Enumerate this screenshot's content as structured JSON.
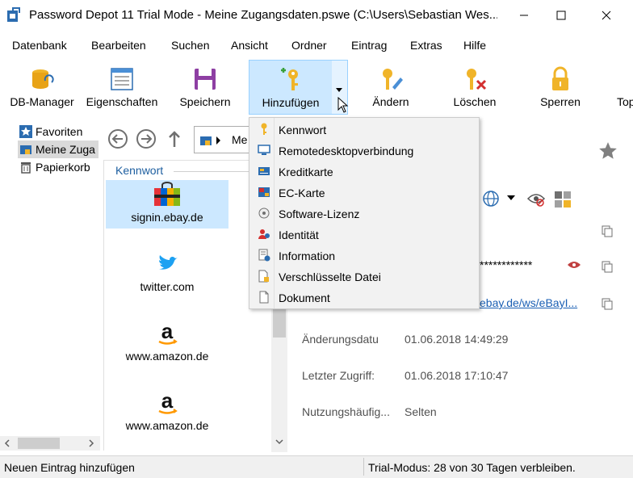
{
  "window": {
    "title": "Password Depot 11 Trial Mode - Meine Zugangsdaten.pswe (C:\\Users\\Sebastian Wes..."
  },
  "menu": [
    "Datenbank",
    "Bearbeiten",
    "Suchen",
    "Ansicht",
    "Ordner",
    "Eintrag",
    "Extras",
    "Hilfe"
  ],
  "toolbar": {
    "db_manager": "DB-Manager",
    "properties": "Eigenschaften",
    "save": "Speichern",
    "add": "Hinzufügen",
    "edit": "Ändern",
    "delete": "Löschen",
    "lock": "Sperren",
    "more": "Top"
  },
  "tree": {
    "favorites": "Favoriten",
    "my_data": "Meine Zuga",
    "trash": "Papierkorb"
  },
  "nav": {
    "path": "Me"
  },
  "list": {
    "header": "Kennwort",
    "items": [
      {
        "label": "signin.ebay.de",
        "icon": "ebay-icon"
      },
      {
        "label": "twitter.com",
        "icon": "twitter-icon"
      },
      {
        "label": "www.amazon.de",
        "icon": "amazon-icon"
      },
      {
        "label": "www.amazon.de",
        "icon": "amazon-icon"
      }
    ]
  },
  "details": {
    "password_mask": "************",
    "url": "ebay.de/ws/eBayI...",
    "changed_label": "Änderungsdatu",
    "changed_value": "01.06.2018 14:49:29",
    "accessed_label": "Letzter Zugriff:",
    "accessed_value": "01.06.2018 17:10:47",
    "usage_label": "Nutzungshäufig...",
    "usage_value": "Selten"
  },
  "add_menu": {
    "items": [
      {
        "label": "Kennwort",
        "icon": "key-icon"
      },
      {
        "label": "Remotedesktopverbindung",
        "icon": "monitor-icon"
      },
      {
        "label": "Kreditkarte",
        "icon": "credit-card-icon"
      },
      {
        "label": "EC-Karte",
        "icon": "ec-card-icon"
      },
      {
        "label": "Software-Lizenz",
        "icon": "license-icon"
      },
      {
        "label": "Identität",
        "icon": "identity-icon"
      },
      {
        "label": "Information",
        "icon": "info-icon"
      },
      {
        "label": "Verschlüsselte Datei",
        "icon": "encrypted-file-icon"
      },
      {
        "label": "Dokument",
        "icon": "document-icon"
      }
    ]
  },
  "status": {
    "left": "Neuen Eintrag hinzufügen",
    "right": "Trial-Modus: 28 von 30 Tagen verbleiben."
  },
  "colors": {
    "accent": "#cce8ff",
    "link": "#1a5fb4",
    "header_blue": "#1e5fa0"
  }
}
